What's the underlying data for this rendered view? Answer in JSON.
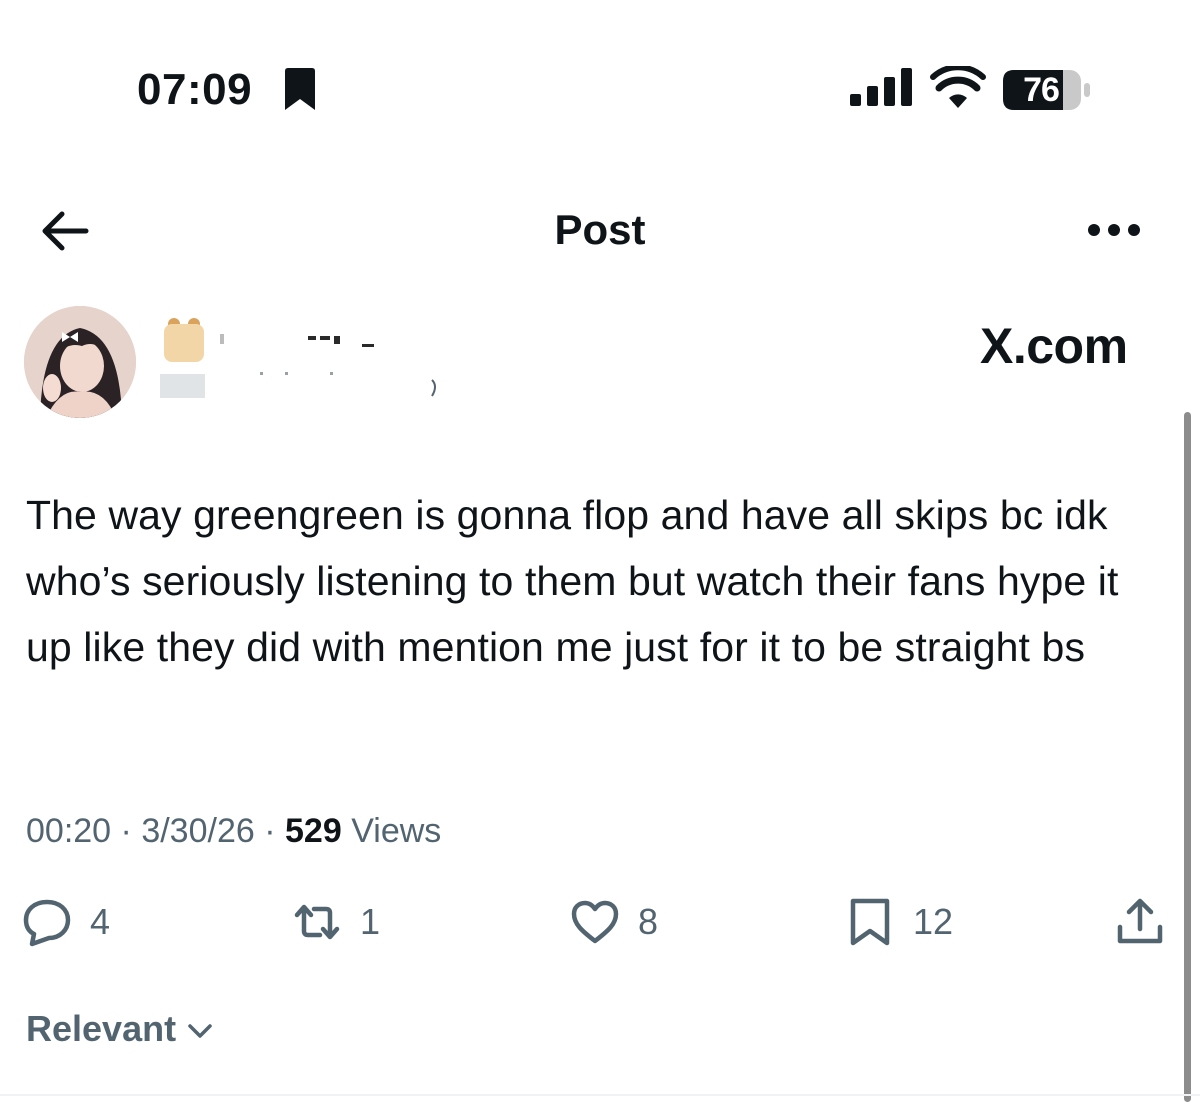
{
  "status_bar": {
    "time": "07:09",
    "battery": "76"
  },
  "header": {
    "title": "Post"
  },
  "author": {
    "watermark": "X.com"
  },
  "post": {
    "text": "The way greengreen is gonna flop and have all skips bc idk who’s seriously listening to them but watch their fans hype it up like they did with mention me just for it to be straight bs",
    "time": "00:20",
    "date": "3/30/26",
    "views_count": "529",
    "views_label": "Views",
    "separator": "·"
  },
  "actions": {
    "replies": "4",
    "reposts": "1",
    "likes": "8",
    "bookmarks": "12"
  },
  "sort": {
    "label": "Relevant"
  },
  "colors": {
    "text_primary": "#0f1419",
    "text_secondary": "#536471",
    "background": "#ffffff"
  }
}
